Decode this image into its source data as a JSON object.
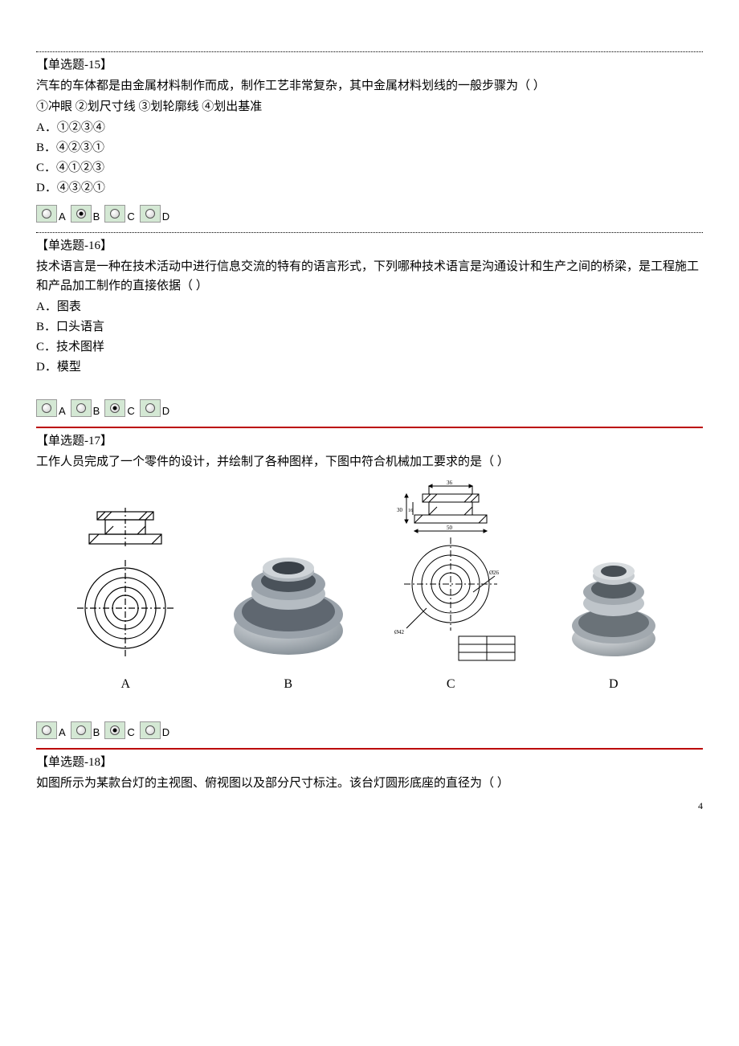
{
  "page_number": "4",
  "q15": {
    "title": "【单选题-15】",
    "stem": "汽车的车体都是由金属材料制作而成，制作工艺非常复杂，其中金属材料划线的一般步骤为（  ）",
    "sub": "①冲眼 ②划尺寸线 ③划轮廓线 ④划出基准",
    "optA": "A．①②③④",
    "optB": "B．④②③①",
    "optC": "C．④①②③",
    "optD": "D．④③②①",
    "labels": {
      "a": "A",
      "b": "B",
      "c": "C",
      "d": "D"
    },
    "selected": "B"
  },
  "q16": {
    "title": "【单选题-16】",
    "stem": "技术语言是一种在技术活动中进行信息交流的特有的语言形式，下列哪种技术语言是沟通设计和生产之间的桥梁，是工程施工和产品加工制作的直接依据（  ）",
    "optA": "A．图表",
    "optB": "B．口头语言",
    "optC": "C．技术图样",
    "optD": "D．模型",
    "labels": {
      "a": "A",
      "b": "B",
      "c": "C",
      "d": "D"
    },
    "selected": "C"
  },
  "q17": {
    "title": "【单选题-17】",
    "stem": "工作人员完成了一个零件的设计，并绘制了各种图样，下图中符合机械加工要求的是（  ）",
    "img_labels": {
      "a": "A",
      "b": "B",
      "c": "C",
      "d": "D"
    },
    "labels": {
      "a": "A",
      "b": "B",
      "c": "C",
      "d": "D"
    },
    "selected": "C"
  },
  "q18": {
    "title": "【单选题-18】",
    "stem": "如图所示为某款台灯的主视图、俯视图以及部分尺寸标注。该台灯圆形底座的直径为（  ）"
  }
}
